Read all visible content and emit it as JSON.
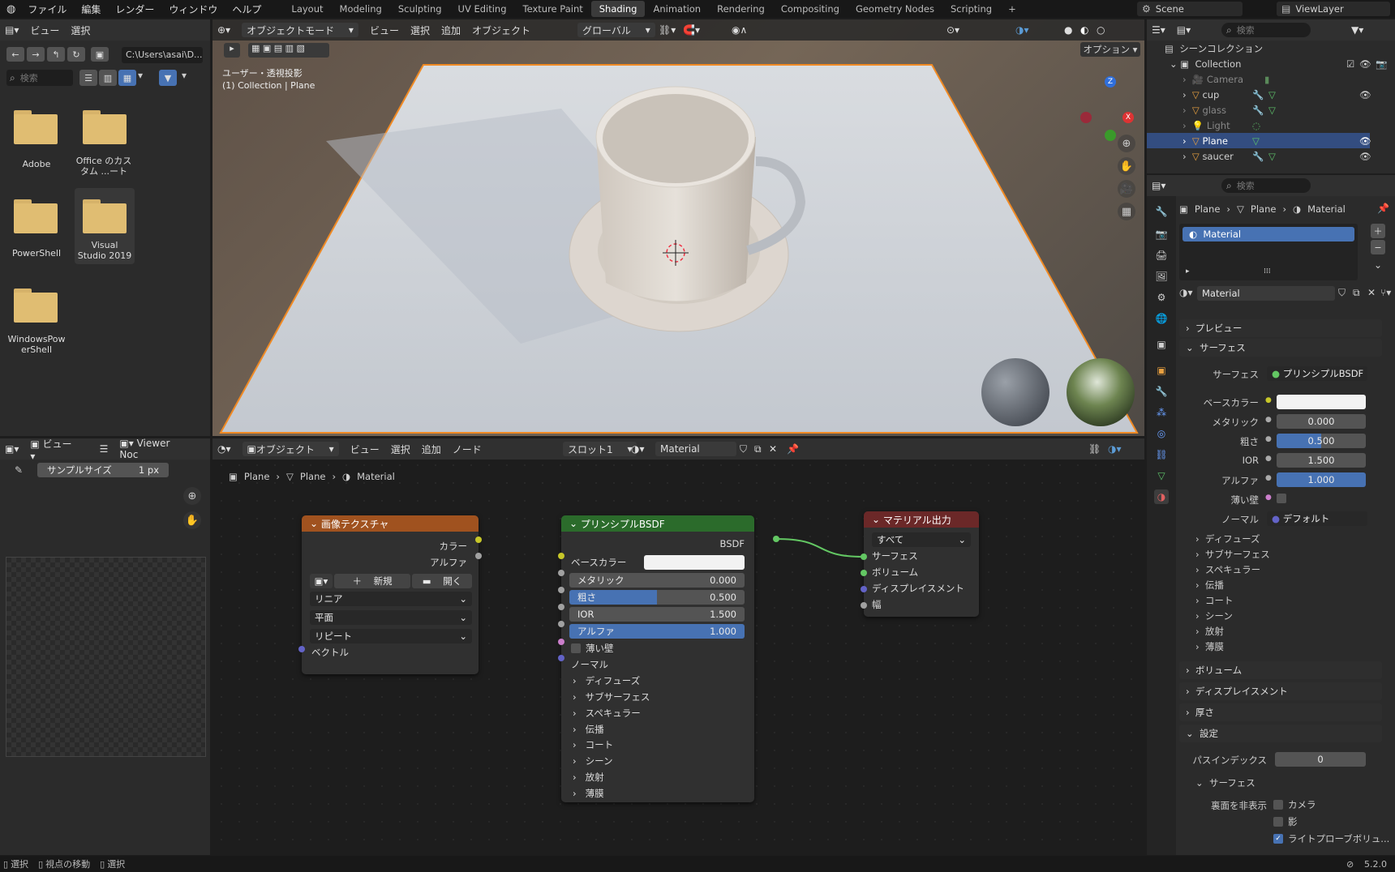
{
  "topbar": {
    "menus": [
      "ファイル",
      "編集",
      "レンダー",
      "ウィンドウ",
      "ヘルプ"
    ],
    "workspaces": [
      "Layout",
      "Modeling",
      "Sculpting",
      "UV Editing",
      "Texture Paint",
      "Shading",
      "Animation",
      "Rendering",
      "Compositing",
      "Geometry Nodes",
      "Scripting"
    ],
    "active_workspace": "Shading",
    "scene": "Scene",
    "viewlayer": "ViewLayer"
  },
  "filebrowser": {
    "menus": [
      "ビュー",
      "選択"
    ],
    "path": "C:\\Users\\asai\\D...",
    "search_placeholder": "検索",
    "items": [
      {
        "label": "Adobe"
      },
      {
        "label": "Office のカス\nタム ...ート"
      },
      {
        "label": "PowerShell"
      },
      {
        "label": "Visual\nStudio 2019"
      },
      {
        "label": "WindowsPow\nerShell"
      }
    ]
  },
  "viewport": {
    "mode": "オブジェクトモード",
    "menus": [
      "ビュー",
      "選択",
      "追加",
      "オブジェクト"
    ],
    "transform": "グローバル",
    "options": "オプション",
    "view_label": "ユーザー・透視投影",
    "collection_label": "(1) Collection | Plane",
    "axis": {
      "z": "Z",
      "x": "X"
    }
  },
  "imageeditor": {
    "view": "ビュー",
    "viewer": "Viewer Noc",
    "sample_label": "サンプルサイズ",
    "sample_value": "1 px"
  },
  "nodeeditor": {
    "object": "オブジェクト",
    "menus": [
      "ビュー",
      "選択",
      "追加",
      "ノード"
    ],
    "slot": "スロット1",
    "material": "Material",
    "breadcrumb": [
      "Plane",
      "Plane",
      "Material"
    ],
    "image_texture": {
      "title": "画像テクスチャ",
      "out_color": "カラー",
      "out_alpha": "アルファ",
      "new": "新規",
      "open": "開く",
      "interp": "リニア",
      "projection": "平面",
      "extension": "リピート",
      "vector": "ベクトル"
    },
    "bsdf": {
      "title": "プリンシプルBSDF",
      "out": "BSDF",
      "base_color": "ベースカラー",
      "metallic_label": "メタリック",
      "metallic": "0.000",
      "rough_label": "粗さ",
      "rough": "0.500",
      "ior_label": "IOR",
      "ior": "1.500",
      "alpha_label": "アルファ",
      "alpha": "1.000",
      "thin": "薄い壁",
      "normal": "ノーマル",
      "subs": [
        "ディフューズ",
        "サブサーフェス",
        "スペキュラー",
        "伝播",
        "コート",
        "シーン",
        "放射",
        "薄膜"
      ]
    },
    "output": {
      "title": "マテリアル出力",
      "target": "すべて",
      "surface": "サーフェス",
      "volume": "ボリューム",
      "displacement": "ディスプレイスメント",
      "width": "幅"
    }
  },
  "outliner": {
    "search_placeholder": "検索",
    "scene_collection": "シーンコレクション",
    "collection": "Collection",
    "items": [
      "Camera",
      "cup",
      "glass",
      "Light",
      "Plane",
      "saucer"
    ]
  },
  "properties": {
    "search_placeholder": "検索",
    "breadcrumb": [
      "Plane",
      "Plane",
      "Material"
    ],
    "slot": "Material",
    "material_name": "Material",
    "preview": "プレビュー",
    "surface_section": "サーフェス",
    "surface_label": "サーフェス",
    "surface_value": "プリンシプルBSDF",
    "base_color": "ベースカラー",
    "metallic_label": "メタリック",
    "metallic": "0.000",
    "rough_label": "粗さ",
    "rough": "0.500",
    "ior_label": "IOR",
    "ior": "1.500",
    "alpha_label": "アルファ",
    "alpha": "1.000",
    "thin": "薄い壁",
    "normal_label": "ノーマル",
    "normal_value": "デフォルト",
    "subs": [
      "ディフューズ",
      "サブサーフェス",
      "スペキュラー",
      "伝播",
      "コート",
      "シーン",
      "放射",
      "薄膜"
    ],
    "volume": "ボリューム",
    "displacement": "ディスプレイスメント",
    "thickness": "厚さ",
    "settings": "設定",
    "pass_index_label": "パスインデックス",
    "pass_index": "0",
    "settings_surface": "サーフェス",
    "backface_label": "裏面を非表示",
    "camera": "カメラ",
    "shadow": "影",
    "lightprobe": "ライトプローブボリュ..."
  },
  "statusbar": {
    "items": [
      "選択",
      "視点の移動",
      "選択"
    ],
    "version": "5.2.0"
  },
  "colors": {
    "accent": "#4772b3",
    "node_texture": "#a0521f",
    "node_shader": "#2b6b2b",
    "node_output": "#6b2828",
    "selection": "#f08a24"
  }
}
